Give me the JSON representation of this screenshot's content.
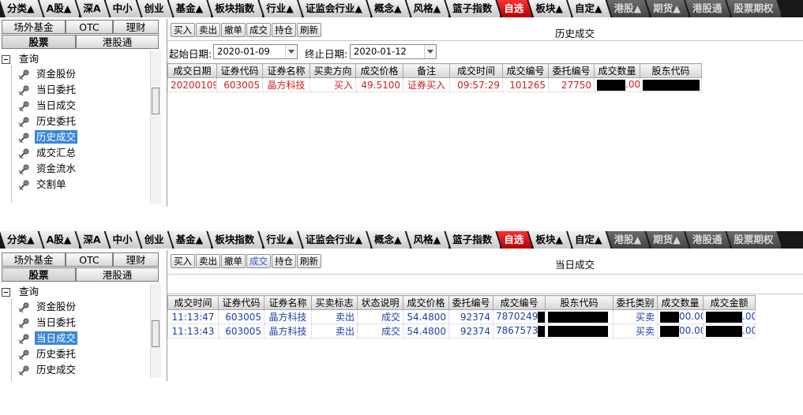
{
  "top_tabs": [
    {
      "label": "分类▲",
      "state": "normal"
    },
    {
      "label": "A股▲",
      "state": "normal"
    },
    {
      "label": "深A",
      "state": "normal"
    },
    {
      "label": "中小",
      "state": "normal"
    },
    {
      "label": "创业",
      "state": "normal"
    },
    {
      "label": "基金▲",
      "state": "normal"
    },
    {
      "label": "板块指数",
      "state": "normal"
    },
    {
      "label": "行业▲",
      "state": "normal"
    },
    {
      "label": "证监会行业▲",
      "state": "normal"
    },
    {
      "label": "概念▲",
      "state": "normal"
    },
    {
      "label": "风格▲",
      "state": "normal"
    },
    {
      "label": "篮子指数",
      "state": "normal"
    },
    {
      "label": "自选",
      "state": "active"
    },
    {
      "label": "板块▲",
      "state": "normal"
    },
    {
      "label": "自定▲",
      "state": "normal"
    },
    {
      "label": "港股▲",
      "state": "dim"
    },
    {
      "label": "期货▲",
      "state": "dim"
    },
    {
      "label": "港股通",
      "state": "dim"
    },
    {
      "label": "股票期权",
      "state": "dim"
    }
  ],
  "left": {
    "segments_row1": [
      "场外基金",
      "OTC",
      "理财"
    ],
    "segments_row2": [
      "股票",
      "港股通"
    ],
    "tree_root": "查询",
    "tree_items_panel1": [
      "资金股份",
      "当日委托",
      "当日成交",
      "历史委托",
      "历史成交",
      "成交汇总",
      "资金流水",
      "交割单"
    ],
    "tree_selected_panel1": "历史成交",
    "tree_items_panel2": [
      "资金股份",
      "当日委托",
      "当日成交",
      "历史委托",
      "历史成交"
    ],
    "tree_selected_panel2": "当日成交"
  },
  "toolbar": {
    "buttons": [
      "买入",
      "卖出",
      "撤单",
      "成交",
      "持仓",
      "刷新"
    ]
  },
  "panel1": {
    "title": "历史成交",
    "start_label": "起始日期:",
    "start_date": "2020-01-09",
    "end_label": "终止日期:",
    "end_date": "2020-01-12",
    "columns": [
      "成交日期",
      "证券代码",
      "证券名称",
      "买卖方向",
      "成交价格",
      "备注",
      "成交时间",
      "成交编号",
      "委托编号",
      "成交数量",
      "股东代码"
    ],
    "rows": [
      {
        "date": "20200109",
        "code": "603005",
        "name": "晶方科技",
        "side": "买入",
        "price": "49.5100",
        "note": "证券买入",
        "time": "09:57:29",
        "deal_no": "101265",
        "order_no_visible": "27750",
        "qty_visible": ".00"
      }
    ]
  },
  "panel2": {
    "title": "当日成交",
    "active_button": "成交",
    "columns": [
      "成交时间",
      "证券代码",
      "证券名称",
      "买卖标志",
      "状态说明",
      "成交价格",
      "委托编号",
      "成交编号",
      "股东代码",
      "委托类别",
      "成交数量",
      "成交金额"
    ],
    "rows": [
      {
        "time": "11:13:47",
        "code": "603005",
        "name": "晶方科技",
        "side": "卖出",
        "status": "成交",
        "price": "54.4800",
        "order_no": "92374",
        "deal_no_visible": "7870249",
        "type_visible": "买卖",
        "qty_visible": "00.00",
        "amount_visible": ".00"
      },
      {
        "time": "11:13:43",
        "code": "603005",
        "name": "晶方科技",
        "side": "卖出",
        "status": "成交",
        "price": "54.4800",
        "order_no": "92374",
        "deal_no_visible": "7867573",
        "type_visible": "买卖",
        "qty_visible": "00.00",
        "amount_visible": ".00"
      }
    ]
  },
  "colors": {
    "active_tab": "#d41a1a",
    "selection": "#3a86d6",
    "row_red": "#d12020",
    "row_blue": "#1d3fa8",
    "redaction": "#000000"
  }
}
